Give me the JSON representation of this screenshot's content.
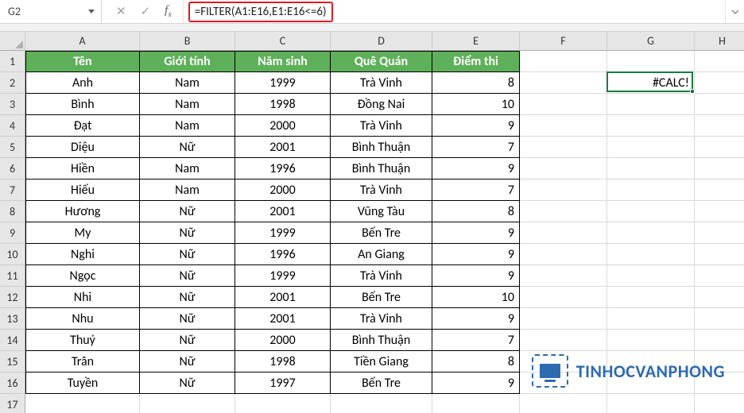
{
  "formula_bar": {
    "name_box": "G2",
    "formula": "=FILTER(A1:E16,E1:E16<=6)"
  },
  "columns": [
    "A",
    "B",
    "C",
    "D",
    "E",
    "F",
    "G",
    "H"
  ],
  "row_numbers": [
    1,
    2,
    3,
    4,
    5,
    6,
    7,
    8,
    9,
    10,
    11,
    12,
    13,
    14,
    15,
    16,
    17
  ],
  "headers": [
    "Tên",
    "Giới tính",
    "Năm sinh",
    "Quê Quán",
    "Điểm thi"
  ],
  "rows": [
    {
      "ten": "Anh",
      "gioi": "Nam",
      "nam": "1999",
      "que": "Trà Vinh",
      "diem": "8"
    },
    {
      "ten": "Bình",
      "gioi": "Nam",
      "nam": "1998",
      "que": "Đồng Nai",
      "diem": "10"
    },
    {
      "ten": "Đạt",
      "gioi": "Nam",
      "nam": "2000",
      "que": "Trà Vinh",
      "diem": "9"
    },
    {
      "ten": "Diệu",
      "gioi": "Nữ",
      "nam": "2001",
      "que": "Bình Thuận",
      "diem": "7"
    },
    {
      "ten": "Hiền",
      "gioi": "Nam",
      "nam": "1996",
      "que": "Bình Thuận",
      "diem": "9"
    },
    {
      "ten": "Hiếu",
      "gioi": "Nam",
      "nam": "2000",
      "que": "Trà Vinh",
      "diem": "7"
    },
    {
      "ten": "Hương",
      "gioi": "Nữ",
      "nam": "2001",
      "que": "Vũng Tàu",
      "diem": "8"
    },
    {
      "ten": "My",
      "gioi": "Nữ",
      "nam": "1999",
      "que": "Bến Tre",
      "diem": "9"
    },
    {
      "ten": "Nghi",
      "gioi": "Nữ",
      "nam": "1996",
      "que": "An Giang",
      "diem": "9"
    },
    {
      "ten": "Ngọc",
      "gioi": "Nữ",
      "nam": "1999",
      "que": "Trà Vinh",
      "diem": "9"
    },
    {
      "ten": "Nhi",
      "gioi": "Nữ",
      "nam": "2001",
      "que": "Bến Tre",
      "diem": "10"
    },
    {
      "ten": "Nhu",
      "gioi": "Nữ",
      "nam": "2001",
      "que": "Trà Vinh",
      "diem": "9"
    },
    {
      "ten": "Thuỷ",
      "gioi": "Nữ",
      "nam": "2000",
      "que": "Bình Thuận",
      "diem": "7"
    },
    {
      "ten": "Trân",
      "gioi": "Nữ",
      "nam": "1998",
      "que": "Tiền Giang",
      "diem": "8"
    },
    {
      "ten": "Tuyền",
      "gioi": "Nữ",
      "nam": "1997",
      "que": "Bến Tre",
      "diem": "9"
    }
  ],
  "g2_value": "#CALC!",
  "watermark": "TINHOCVANPHONG"
}
